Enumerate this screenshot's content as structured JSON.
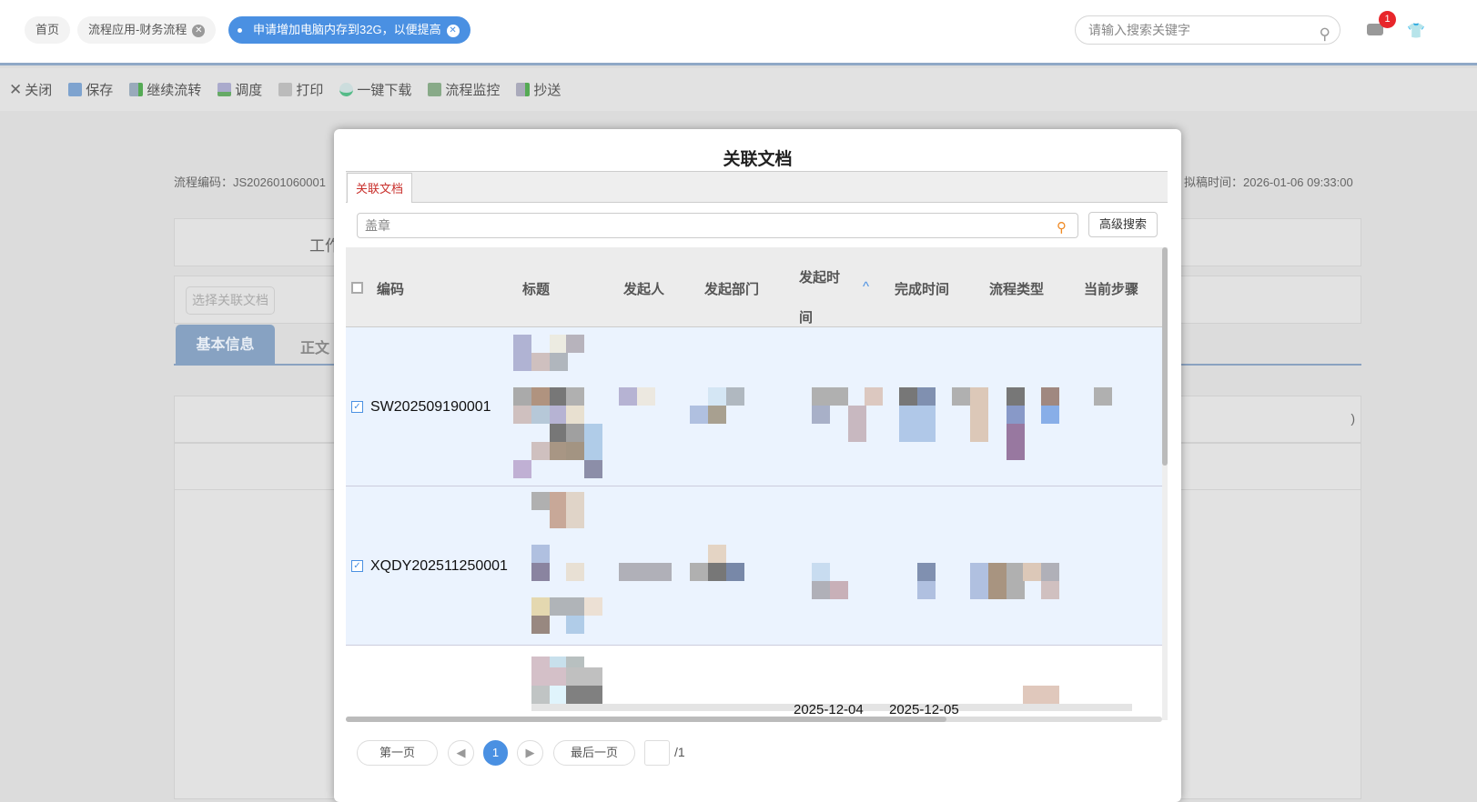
{
  "tabs": [
    {
      "label": "首页"
    },
    {
      "label": "流程应用-财务流程"
    },
    {
      "label": "申请增加电脑内存到32G，以便提高"
    }
  ],
  "global_search": {
    "placeholder": "请输入搜索关键字"
  },
  "notifications": {
    "count": "1"
  },
  "toolbar": [
    {
      "label": "关闭",
      "icon": "close-icon"
    },
    {
      "label": "保存",
      "icon": "save-icon"
    },
    {
      "label": "继续流转",
      "icon": "forward-icon"
    },
    {
      "label": "调度",
      "icon": "dispatch-icon"
    },
    {
      "label": "打印",
      "icon": "print-icon"
    },
    {
      "label": "一键下载",
      "icon": "download-icon"
    },
    {
      "label": "流程监控",
      "icon": "monitor-icon"
    },
    {
      "label": "抄送",
      "icon": "cc-icon"
    }
  ],
  "background": {
    "flow_code": "流程编码：JS202601060001",
    "draft_time": "拟稿时间：2026-01-06 09:33:00",
    "partial_title": "工作",
    "select_related_button": "选择关联文档",
    "tab_basic": "基本信息",
    "tab_body": "正文",
    "partial_paren": ")"
  },
  "modal": {
    "title": "关联文档",
    "tab": "关联文档",
    "search_value": "盖章",
    "advanced_search": "高级搜索",
    "columns": [
      "编码",
      "标题",
      "发起人",
      "发起部门",
      "发起时间",
      "完成时间",
      "流程类型",
      "当前步骤"
    ],
    "sort_indicator": "^",
    "rows": [
      {
        "code": "SW202509190001",
        "checked": true
      },
      {
        "code": "XQDY202511250001",
        "checked": true
      },
      {
        "code": "",
        "checked": false,
        "start_time": "2025-12-04",
        "end_time": "2025-12-05"
      }
    ],
    "pager": {
      "first": "第一页",
      "current": "1",
      "last": "最后一页",
      "page_input": "",
      "total": "/1"
    }
  }
}
